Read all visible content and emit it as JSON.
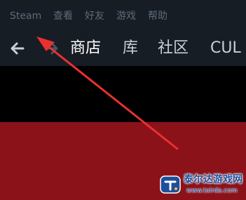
{
  "menubar": {
    "items": [
      {
        "label": "Steam"
      },
      {
        "label": "查看"
      },
      {
        "label": "好友"
      },
      {
        "label": "游戏"
      },
      {
        "label": "帮助"
      }
    ]
  },
  "navbar": {
    "back_icon": "back-arrow-icon",
    "forward_icon": "forward-arrow-icon",
    "tabs": [
      {
        "label": "商店",
        "active": true
      },
      {
        "label": "库",
        "active": false
      },
      {
        "label": "社区",
        "active": false
      },
      {
        "label": "CUL",
        "active": false
      }
    ]
  },
  "annotation": {
    "color": "#e8312f"
  },
  "watermark": {
    "title": "泰尔达游戏网",
    "url": "www.tairda.com"
  },
  "colors": {
    "window_bg": "#171d25",
    "menu_text": "#5c6b7a",
    "tab_text": "#c7d0d8",
    "content_dark": "#000000",
    "content_red": "#8c1219",
    "watermark_blue": "#1f4e9c"
  }
}
